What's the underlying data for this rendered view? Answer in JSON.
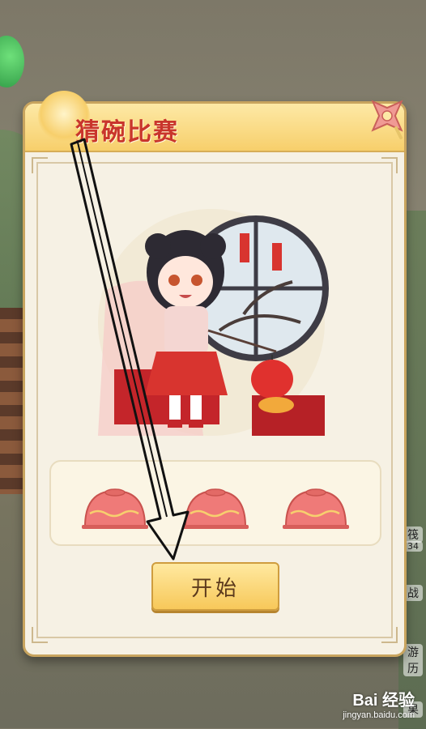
{
  "modal": {
    "title": "猜碗比赛",
    "start_label": "开始"
  },
  "side_labels": [
    "筏",
    "34",
    "战",
    "游历",
    "果"
  ],
  "watermark": {
    "brand": "Bai 经验",
    "url": "jingyan.baidu.com"
  },
  "colors": {
    "title_red": "#c9352c",
    "button_gold": "#f7c85a",
    "bowl_red": "#ef7a78",
    "frame_gold": "#c8a45e"
  },
  "icons": [
    "close-icon",
    "bowl-icon",
    "arrow-annotation"
  ]
}
